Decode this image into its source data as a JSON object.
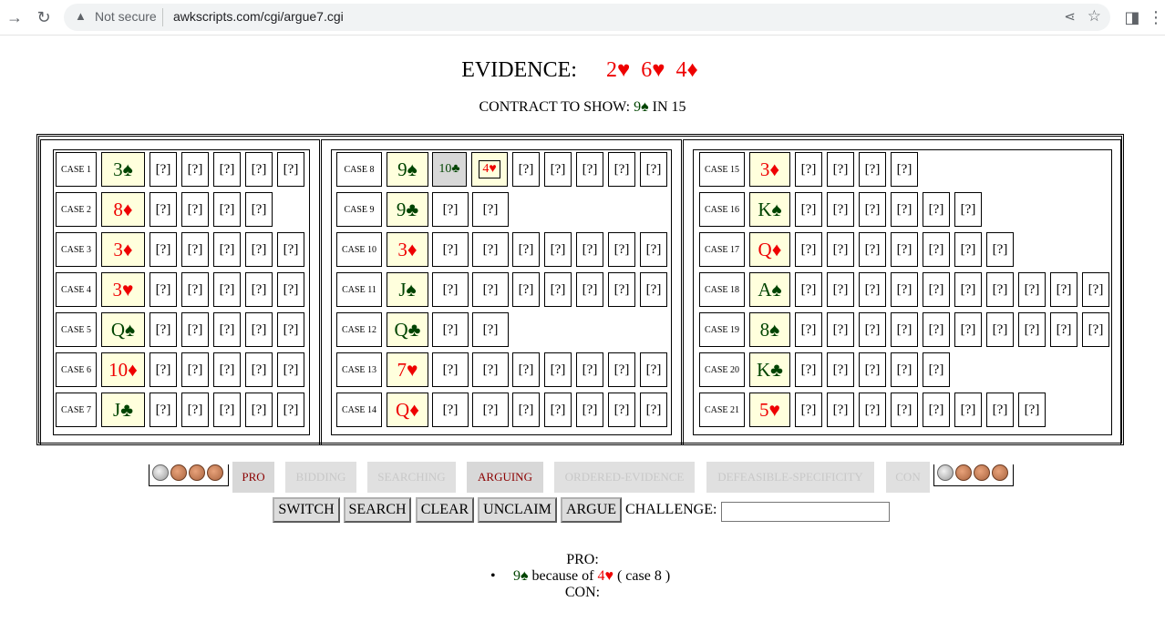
{
  "browser": {
    "security_label": "Not secure",
    "url": "awkscripts.com/cgi/argue7.cgi"
  },
  "evidence": {
    "label": "EVIDENCE:",
    "cards": [
      {
        "text": "2♥",
        "color": "red"
      },
      {
        "text": "6♥",
        "color": "red"
      },
      {
        "text": "4♦",
        "color": "red"
      }
    ]
  },
  "contract": {
    "prefix": "CONTRACT TO SHOW: ",
    "card": "9♠",
    "suffix": " IN 15"
  },
  "panels": [
    {
      "cases": [
        {
          "label": "CASE 1",
          "card": "3♠",
          "color": "green",
          "unknowns": 5
        },
        {
          "label": "CASE 2",
          "card": "8♦",
          "color": "red",
          "unknowns": 4
        },
        {
          "label": "CASE 3",
          "card": "3♦",
          "color": "red",
          "unknowns": 5
        },
        {
          "label": "CASE 4",
          "card": "3♥",
          "color": "red",
          "unknowns": 5
        },
        {
          "label": "CASE 5",
          "card": "Q♠",
          "color": "green",
          "unknowns": 5
        },
        {
          "label": "CASE 6",
          "card": "10♦",
          "color": "red",
          "unknowns": 5
        },
        {
          "label": "CASE 7",
          "card": "J♣",
          "color": "green",
          "unknowns": 5
        }
      ]
    },
    {
      "cases": [
        {
          "label": "CASE 8",
          "card": "9♠",
          "color": "green",
          "extra": [
            {
              "text": "10♣",
              "color": "green",
              "style": "gray"
            },
            {
              "text": "4♥",
              "color": "red",
              "style": "boxed"
            }
          ],
          "unknowns": 5
        },
        {
          "label": "CASE 9",
          "card": "9♣",
          "color": "green",
          "unknowns": 2
        },
        {
          "label": "CASE 10",
          "card": "3♦",
          "color": "red",
          "unknowns": 7
        },
        {
          "label": "CASE 11",
          "card": "J♠",
          "color": "green",
          "unknowns": 7
        },
        {
          "label": "CASE 12",
          "card": "Q♣",
          "color": "green",
          "unknowns": 2
        },
        {
          "label": "CASE 13",
          "card": "7♥",
          "color": "red",
          "unknowns": 7
        },
        {
          "label": "CASE 14",
          "card": "Q♦",
          "color": "red",
          "unknowns": 7
        }
      ]
    },
    {
      "cases": [
        {
          "label": "CASE 15",
          "card": "3♦",
          "color": "red",
          "unknowns": 4
        },
        {
          "label": "CASE 16",
          "card": "K♠",
          "color": "green",
          "unknowns": 6
        },
        {
          "label": "CASE 17",
          "card": "Q♦",
          "color": "red",
          "unknowns": 7
        },
        {
          "label": "CASE 18",
          "card": "A♠",
          "color": "green",
          "unknowns": 10
        },
        {
          "label": "CASE 19",
          "card": "8♠",
          "color": "green",
          "unknowns": 10
        },
        {
          "label": "CASE 20",
          "card": "K♣",
          "color": "green",
          "unknowns": 5
        },
        {
          "label": "CASE 21",
          "card": "5♥",
          "color": "red",
          "unknowns": 8
        }
      ]
    }
  ],
  "unknown_text": "[?]",
  "status": [
    {
      "label": "PRO",
      "active": true
    },
    {
      "label": "BIDDING",
      "active": false
    },
    {
      "label": "SEARCHING",
      "active": false
    },
    {
      "label": "ARGUING",
      "active": true
    },
    {
      "label": "ORDERED-EVIDENCE",
      "active": false
    },
    {
      "label": "DEFEASIBLE-SPECIFICITY",
      "active": false
    },
    {
      "label": "CON",
      "active": false
    }
  ],
  "buttons": {
    "switch": "SWITCH",
    "search": "SEARCH",
    "clear": "CLEAR",
    "unclaim": "UNCLAIM",
    "argue": "ARGUE"
  },
  "challenge_label": "CHALLENGE:",
  "challenge_value": "",
  "pro_heading": "PRO:",
  "con_heading": "CON:",
  "pro_claim": {
    "card": "9♠",
    "because": " because of ",
    "evidence": "4♥",
    "case_ref": " ( case 8 )"
  },
  "colors": {
    "red": "#ee0000",
    "green": "#004400",
    "card_bg": "#ffffdd"
  }
}
